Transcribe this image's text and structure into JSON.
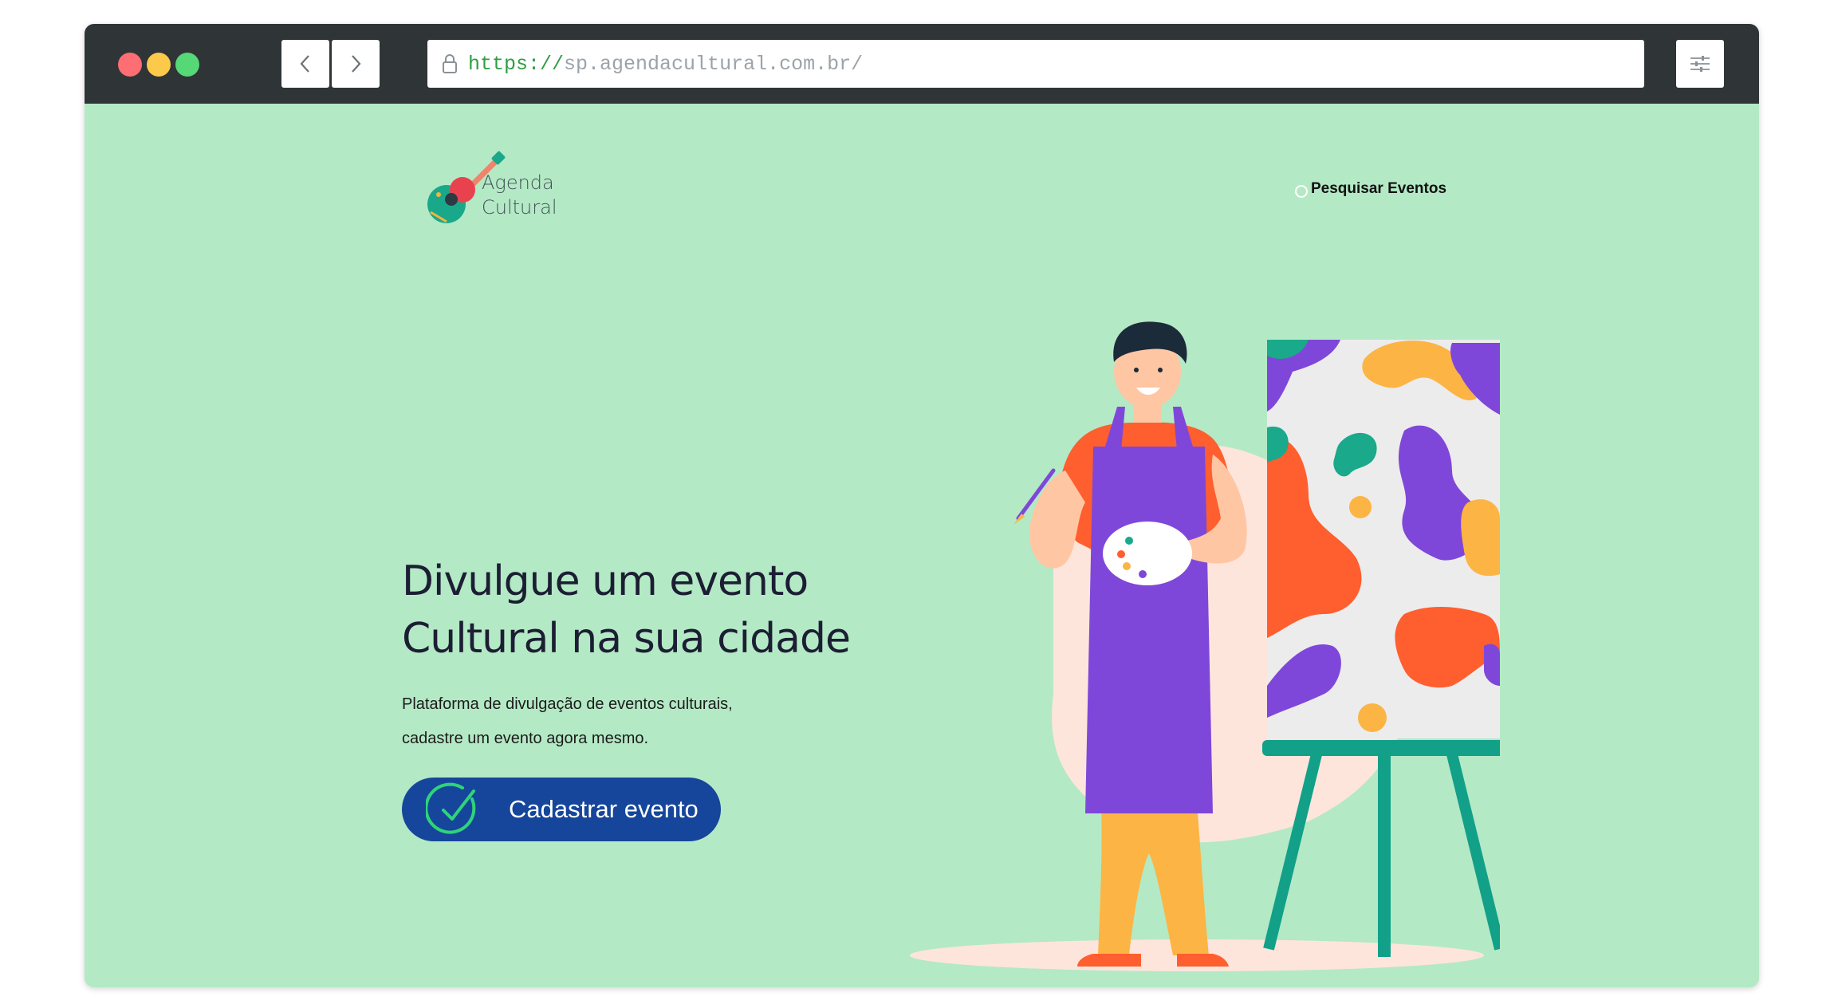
{
  "browser": {
    "url_scheme": "https://",
    "url_host": "sp.agendacultural.com.br/"
  },
  "header": {
    "logo_line1": "Agenda",
    "logo_line2": "Cultural",
    "search_link": "Pesquisar Eventos"
  },
  "hero": {
    "title_line1": "Divulgue um evento",
    "title_line2": "Cultural na sua cidade",
    "desc_line1": "Plataforma de divulgação de eventos culturais,",
    "desc_line2": "cadastre um evento agora mesmo.",
    "cta_label": "Cadastrar evento"
  },
  "colors": {
    "page_bg": "#b4e9c5",
    "cta_bg": "#16469b",
    "title": "#1c1e33",
    "chrome_bg": "#2f3437"
  },
  "icons": [
    "lock-icon",
    "chevron-left-icon",
    "chevron-right-icon",
    "sliders-icon",
    "search-icon",
    "check-circle-icon"
  ]
}
